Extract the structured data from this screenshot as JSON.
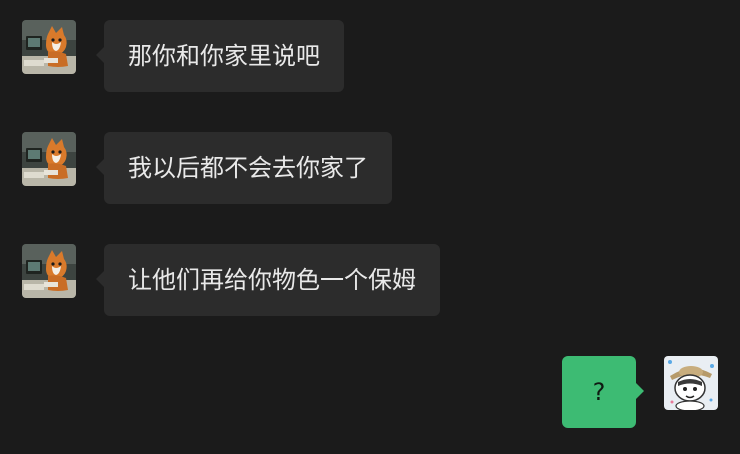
{
  "colors": {
    "background": "#1b1b1b",
    "incoming_bubble": "#2c2c2c",
    "outgoing_bubble": "#3dbb73",
    "incoming_text": "#e9e9e9",
    "outgoing_text": "#0f1a12"
  },
  "messages": [
    {
      "side": "left",
      "text": "那你和你家里说吧",
      "avatar": "cat-at-computer-avatar"
    },
    {
      "side": "left",
      "text": "我以后都不会去你家了",
      "avatar": "cat-at-computer-avatar"
    },
    {
      "side": "left",
      "text": "让他们再给你物色一个保姆",
      "avatar": "cat-at-computer-avatar"
    },
    {
      "side": "right",
      "text": "?",
      "avatar": "cartoon-character-with-hat-avatar"
    }
  ]
}
